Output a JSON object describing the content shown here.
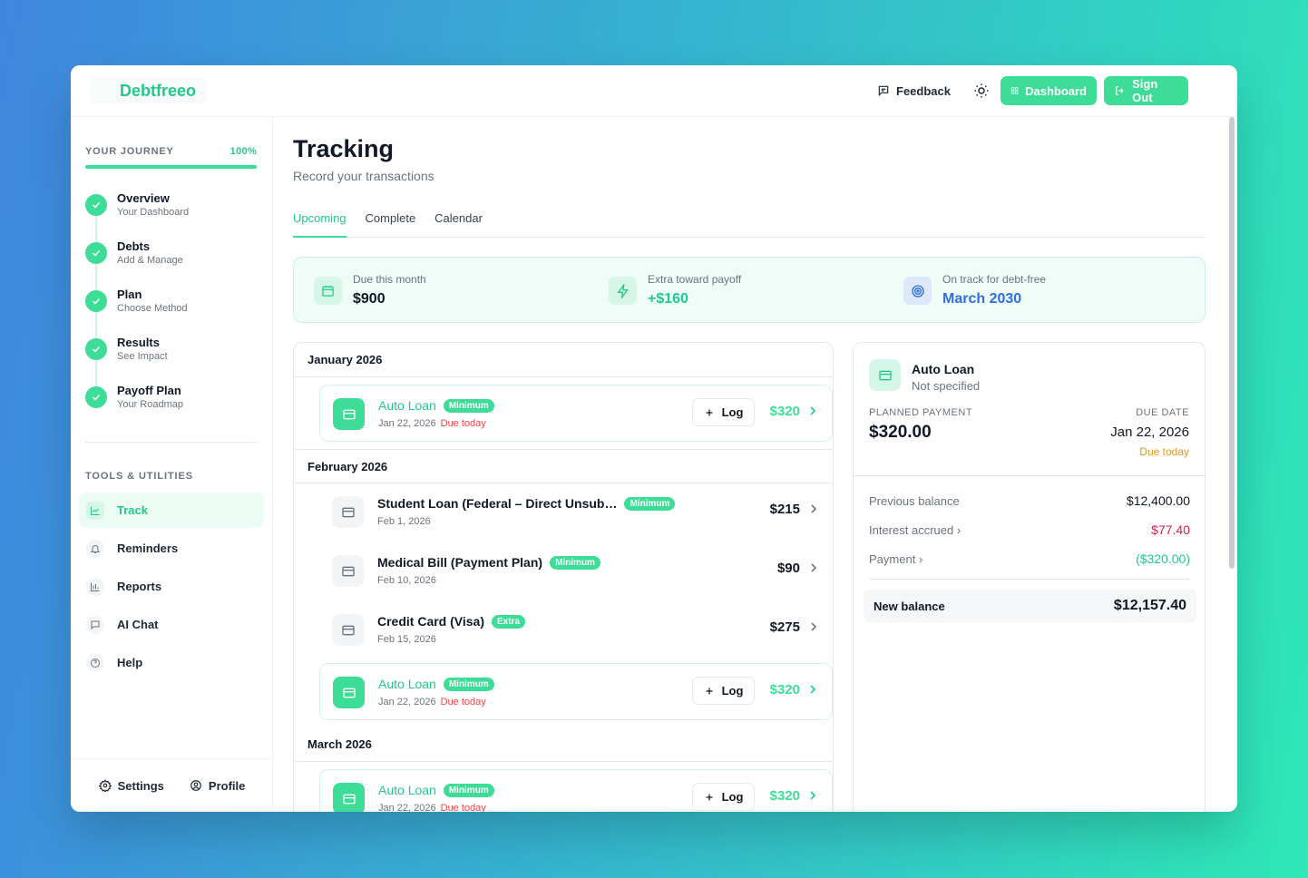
{
  "app": {
    "name": "Debtfreeo"
  },
  "header": {
    "feedback_label": "Feedback",
    "theme_icon": "sun-icon",
    "dashboard_label": "Dashboard",
    "signout_label": "Sign Out"
  },
  "sidebar": {
    "journey_title": "YOUR JOURNEY",
    "journey_pct_label": "100%",
    "journey_progress": 1.0,
    "steps": [
      {
        "title": "Overview",
        "subtitle": "Your Dashboard"
      },
      {
        "title": "Debts",
        "subtitle": "Add & Manage"
      },
      {
        "title": "Plan",
        "subtitle": "Choose Method"
      },
      {
        "title": "Results",
        "subtitle": "See Impact"
      },
      {
        "title": "Payoff Plan",
        "subtitle": "Your Roadmap"
      }
    ],
    "tools_title": "TOOLS & UTILITIES",
    "tools": [
      {
        "label": "Track",
        "icon": "chart-line-icon",
        "active": true
      },
      {
        "label": "Reminders",
        "icon": "bell-icon",
        "active": false
      },
      {
        "label": "Reports",
        "icon": "bar-chart-icon",
        "active": false
      },
      {
        "label": "AI Chat",
        "icon": "chat-icon",
        "active": false
      },
      {
        "label": "Help",
        "icon": "help-circle-icon",
        "active": false
      }
    ],
    "settings_label": "Settings",
    "profile_label": "Profile"
  },
  "main": {
    "title": "Tracking",
    "subtitle": "Record your transactions",
    "tabs": [
      "Upcoming",
      "Complete",
      "Calendar"
    ],
    "active_tab": "Upcoming",
    "summary": [
      {
        "label": "Due this month",
        "value": "$900"
      },
      {
        "label": "Extra toward payoff",
        "value": "+$160"
      },
      {
        "label": "On track for debt-free",
        "value": "March 2030"
      }
    ],
    "months": [
      {
        "name": "January 2026",
        "items": [
          {
            "name": "Auto Loan",
            "badge": "Minimum",
            "date": "Jan 22, 2026",
            "due": "Due today",
            "log": "Log",
            "amount": "$320",
            "highlight": true
          }
        ]
      },
      {
        "name": "February 2026",
        "items": [
          {
            "name": "Student Loan (Federal – Direct Unsub…",
            "badge": "Minimum",
            "date": "Feb 1, 2026",
            "due": "",
            "amount": "$215",
            "highlight": false
          },
          {
            "name": "Medical Bill (Payment Plan)",
            "badge": "Minimum",
            "date": "Feb 10, 2026",
            "due": "",
            "amount": "$90",
            "highlight": false
          },
          {
            "name": "Credit Card (Visa)",
            "badge": "Extra",
            "date": "Feb 15, 2026",
            "due": "",
            "amount": "$275",
            "highlight": false
          },
          {
            "name": "Auto Loan",
            "badge": "Minimum",
            "date": "Jan 22, 2026",
            "due": "Due today",
            "log": "Log",
            "amount": "$320",
            "highlight": true
          }
        ]
      },
      {
        "name": "March 2026",
        "items": [
          {
            "name": "Auto Loan",
            "badge": "Minimum",
            "date": "Jan 22, 2026",
            "due": "Due today",
            "log": "Log",
            "amount": "$320",
            "highlight": true
          }
        ]
      }
    ]
  },
  "detail": {
    "name": "Auto Loan",
    "subtitle": "Not specified",
    "planned_label": "PLANNED PAYMENT",
    "planned_value": "$320.00",
    "due_label": "DUE DATE",
    "due_value": "Jan 22, 2026",
    "due_status": "Due today",
    "prev_label": "Previous balance",
    "prev_value": "$12,400.00",
    "interest_label": "Interest accrued",
    "interest_value": "$77.40",
    "payment_label": "Payment",
    "payment_value": "($320.00)",
    "new_label": "New balance",
    "new_value": "$12,157.40"
  },
  "colors": {
    "accent": "#3ddc97",
    "accent_text": "#22c98a",
    "danger": "#ef4444",
    "warning": "#e09a1a",
    "blue": "#2f6fe0"
  }
}
